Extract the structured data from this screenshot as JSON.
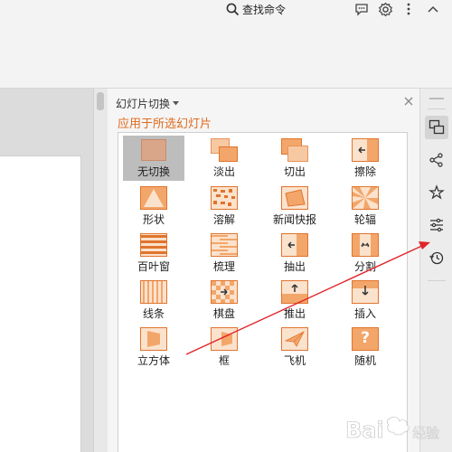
{
  "toolbar": {
    "search_label": "查找命令"
  },
  "panel": {
    "title": "幻灯片切换",
    "apply_label": "应用于所选幻灯片",
    "transitions": [
      {
        "label": "无切换",
        "icon": "none-transition-icon",
        "selected": true
      },
      {
        "label": "淡出",
        "icon": "fade-transition-icon",
        "selected": false
      },
      {
        "label": "切出",
        "icon": "cut-transition-icon",
        "selected": false
      },
      {
        "label": "擦除",
        "icon": "wipe-transition-icon",
        "selected": false
      },
      {
        "label": "形状",
        "icon": "shape-transition-icon",
        "selected": false
      },
      {
        "label": "溶解",
        "icon": "dissolve-transition-icon",
        "selected": false
      },
      {
        "label": "新闻快报",
        "icon": "newsflash-transition-icon",
        "selected": false
      },
      {
        "label": "轮辐",
        "icon": "wheel-transition-icon",
        "selected": false
      },
      {
        "label": "百叶窗",
        "icon": "blinds-transition-icon",
        "selected": false
      },
      {
        "label": "梳理",
        "icon": "comb-transition-icon",
        "selected": false
      },
      {
        "label": "抽出",
        "icon": "pull-transition-icon",
        "selected": false
      },
      {
        "label": "分割",
        "icon": "split-transition-icon",
        "selected": false
      },
      {
        "label": "线条",
        "icon": "lines-transition-icon",
        "selected": false
      },
      {
        "label": "棋盘",
        "icon": "checkerboard-transition-icon",
        "selected": false
      },
      {
        "label": "推出",
        "icon": "push-transition-icon",
        "selected": false
      },
      {
        "label": "插入",
        "icon": "cover-transition-icon",
        "selected": false
      },
      {
        "label": "立方体",
        "icon": "cube-transition-icon",
        "selected": false
      },
      {
        "label": "框",
        "icon": "box-transition-icon",
        "selected": false
      },
      {
        "label": "飞机",
        "icon": "airplane-transition-icon",
        "selected": false
      },
      {
        "label": "随机",
        "icon": "random-transition-icon",
        "selected": false
      },
      {
        "label": "",
        "icon": "random-symbol",
        "text": "?"
      }
    ]
  },
  "sidebar": {
    "items": [
      "transition-icon",
      "share-icon",
      "effects-icon",
      "settings-sliders-icon",
      "history-icon"
    ]
  },
  "watermark": {
    "text": "Bai 经验"
  },
  "colors": {
    "accent": "#e06a1d",
    "icon_orange": "#f2a36b",
    "arrow": "#e0252a"
  }
}
